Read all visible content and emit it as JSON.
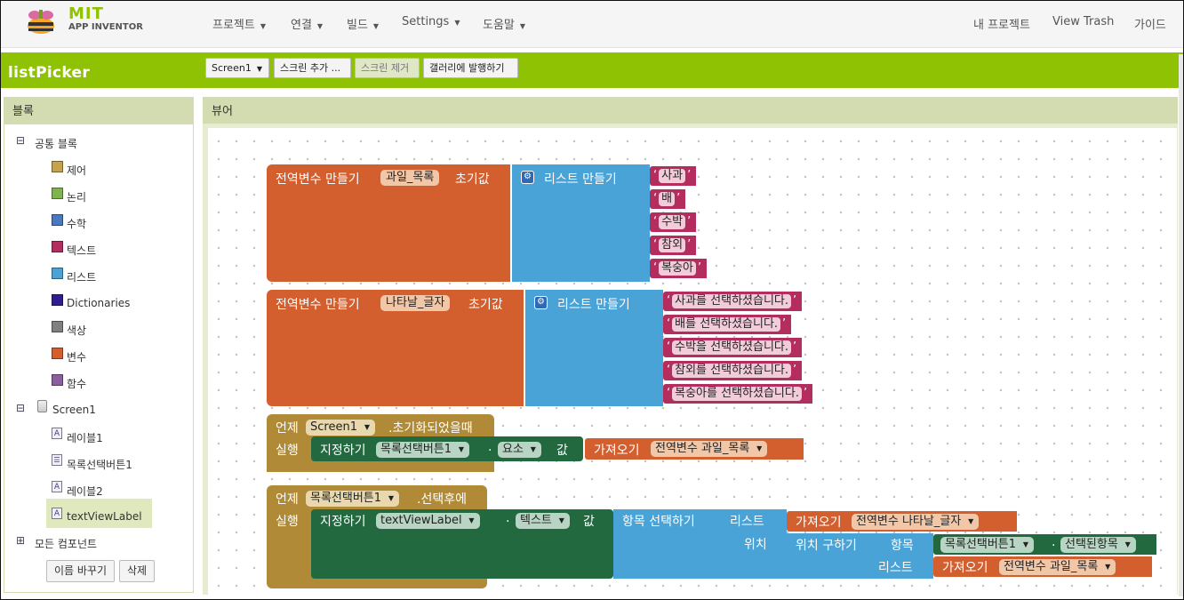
{
  "logo": {
    "mit": "MIT",
    "app_inventor": "APP INVENTOR"
  },
  "nav": {
    "menu": [
      "프로젝트",
      "연결",
      "빌드",
      "Settings",
      "도움말"
    ],
    "right": [
      "내 프로젝트",
      "View Trash",
      "가이드"
    ]
  },
  "project": {
    "title": "listPicker"
  },
  "toolbar": {
    "screen_select": "Screen1",
    "add_screen": "스크린 추가 ...",
    "remove_screen": "스크린 제거",
    "publish_gallery": "갤러리에 발행하기"
  },
  "blocks_panel": {
    "header": "블록",
    "builtin_label": "공통 블록",
    "builtin": [
      {
        "label": "제어",
        "color": "#c8a24a"
      },
      {
        "label": "논리",
        "color": "#80b34d"
      },
      {
        "label": "수학",
        "color": "#4a79bf"
      },
      {
        "label": "텍스트",
        "color": "#b32d5e"
      },
      {
        "label": "리스트",
        "color": "#4aa3d6"
      },
      {
        "label": "Dictionaries",
        "color": "#2d1f8e"
      },
      {
        "label": "색상",
        "color": "#808080"
      },
      {
        "label": "변수",
        "color": "#d35f2e"
      },
      {
        "label": "함수",
        "color": "#8b5e9e"
      }
    ],
    "screen_label": "Screen1",
    "components": [
      {
        "label": "레이블1",
        "icon": "label-icon"
      },
      {
        "label": "목록선택버튼1",
        "icon": "listpicker-icon"
      },
      {
        "label": "레이블2",
        "icon": "label-icon"
      },
      {
        "label": "textViewLabel",
        "icon": "label-icon"
      }
    ],
    "all_components": "모든 컴포넌트",
    "rename_button": "이름 바꾸기",
    "delete_button": "삭제"
  },
  "viewer": {
    "header": "뷰어"
  },
  "workspace": {
    "block1": {
      "init_global": "전역변수 만들기",
      "var_name": "과일_목록",
      "init_to": "초기값",
      "make_list": "리스트 만들기",
      "items": [
        "사과",
        "배",
        "수박",
        "참외",
        "복숭아"
      ]
    },
    "block2": {
      "init_global": "전역변수 만들기",
      "var_name": "나타날_글자",
      "init_to": "초기값",
      "make_list": "리스트 만들기",
      "items": [
        "사과를 선택하셨습니다.",
        "배를 선택하셨습니다.",
        "수박을 선택하셨습니다.",
        "참외를 선택하셨습니다.",
        "복숭아를 선택하셨습니다."
      ]
    },
    "block3": {
      "when": "언제",
      "component": "Screen1",
      "event": ".초기화되었을때",
      "do": "실행",
      "set": "지정하기",
      "target": "목록선택버튼1",
      "dot": ".",
      "prop": "요소",
      "to": "값",
      "get": "가져오기",
      "get_var": "전역변수 과일_목록"
    },
    "block4": {
      "when": "언제",
      "component": "목록선택버튼1",
      "event": ".선택후에",
      "do": "실행",
      "set": "지정하기",
      "target": "textViewLabel",
      "dot": ".",
      "prop": "텍스트",
      "to": "값",
      "select_item": "항목 선택하기",
      "list_label": "리스트",
      "index_label": "위치",
      "get": "가져오기",
      "get_var1": "전역변수 나타날_글자",
      "index_in_list": "위치 구하기",
      "thing_label": "항목",
      "picker": "목록선택버튼1",
      "selection": "선택된항목",
      "list_label2": "리스트",
      "get_var2": "전역변수 과일_목록"
    }
  }
}
